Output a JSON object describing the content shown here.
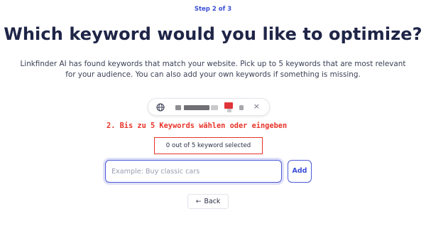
{
  "header": {
    "step": "Step 2 of 3",
    "title": "Which keyword would you like to optimize?",
    "description": "Linkfinder AI has found keywords that match your website. Pick up to 5 keywords that are most relevant for your audience. You can also add your own keywords if something is missing."
  },
  "url_pill": {
    "icon": "globe-icon",
    "close_icon": "×",
    "blur_colors": [
      "#8e8e92",
      "#6f6f74",
      "#c9c9cc",
      "#e0343a",
      "#a8a8ac"
    ]
  },
  "annotation": {
    "text": "2. Bis zu 5 Keywords wählen oder eingeben",
    "color": "#e8342a"
  },
  "keywords": {
    "counter_text": "0 out of 5 keyword selected",
    "input_value": "",
    "input_placeholder": "Example: Buy classic cars",
    "add_label": "Add"
  },
  "navigation": {
    "back_arrow": "←",
    "back_label": "Back"
  },
  "colors": {
    "accent": "#3b4fd8",
    "heading": "#1f2547",
    "annotation_red": "#e8342a"
  }
}
